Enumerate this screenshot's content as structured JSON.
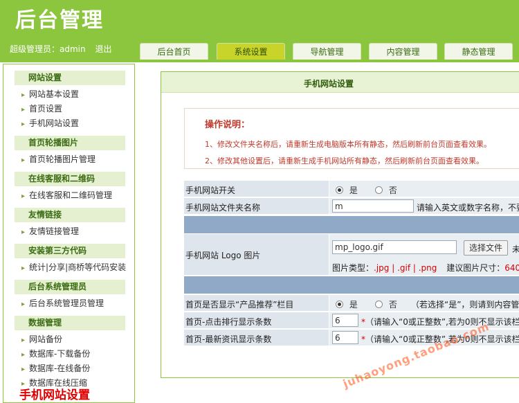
{
  "header": {
    "logo": "后台管理",
    "user_text": "超级管理员：admin",
    "logout": "退出",
    "tabs": [
      {
        "label": "后台首页",
        "active": false
      },
      {
        "label": "系统设置",
        "active": true
      },
      {
        "label": "导航管理",
        "active": false
      },
      {
        "label": "内容管理",
        "active": false
      },
      {
        "label": "静态管理",
        "active": false
      }
    ]
  },
  "sidebar": {
    "groups": [
      {
        "title": "网站设置",
        "items": [
          "网站基本设置",
          "首页设置",
          "手机网站设置"
        ]
      },
      {
        "title": "首页轮播图片",
        "items": [
          "首页轮播图片管理"
        ]
      },
      {
        "title": "在线客服和二维码",
        "items": [
          "在线客服和二维码管理"
        ]
      },
      {
        "title": "友情链接",
        "items": [
          "友情链接管理"
        ]
      },
      {
        "title": "安装第三方代码",
        "items": [
          "统计|分享|商桥等代码安装"
        ]
      },
      {
        "title": "后台系统管理员",
        "items": [
          "后台系统管理员管理"
        ]
      },
      {
        "title": "数据管理",
        "items": [
          "网站备份",
          "数据库-下载备份",
          "数据库-在线备份",
          "数据库在线压缩"
        ]
      }
    ]
  },
  "overlay_title": "手机网站设置",
  "main": {
    "panel_title": "手机网站设置",
    "notes_title": "操作说明：",
    "notes": [
      "1、修改文件夹名称后，请重新生成电脑版本所有静态，然后刷新前台页面查看效果。",
      "2、修改其他设置后，请重新生成手机网站所有静态，然后刷新前台页面查看效果。"
    ],
    "form": {
      "mobile_switch_label": "手机网站开关",
      "yes": "是",
      "no": "否",
      "folder_label": "手机网站文件夹名称",
      "folder_value": "m",
      "folder_hint": "请输入英文或数字名称，不要",
      "logo_label": "手机网站 Logo 图片",
      "logo_value": "mp_logo.gif",
      "choose_file": "选择文件",
      "file_status": "未",
      "img_type_prefix": "图片类型：",
      "img_types": ".jpg | .gif | .png",
      "img_size_prefix": "建议图片尺寸：",
      "img_size": "640 *",
      "product_label": "首页是否显示“产品推荐”栏目",
      "product_hint": "（若选择“是”，则请到内容管",
      "click_rank_label": "首页-点击排行显示条数",
      "click_rank_value": "6",
      "news_label": "首页-最新资讯显示条数",
      "news_value": "6",
      "star": "*",
      "count_hint": "（请输入“0或正整数”,若为0则不显示该栏"
    }
  },
  "watermark": "juhaoyong.taobao.com"
}
